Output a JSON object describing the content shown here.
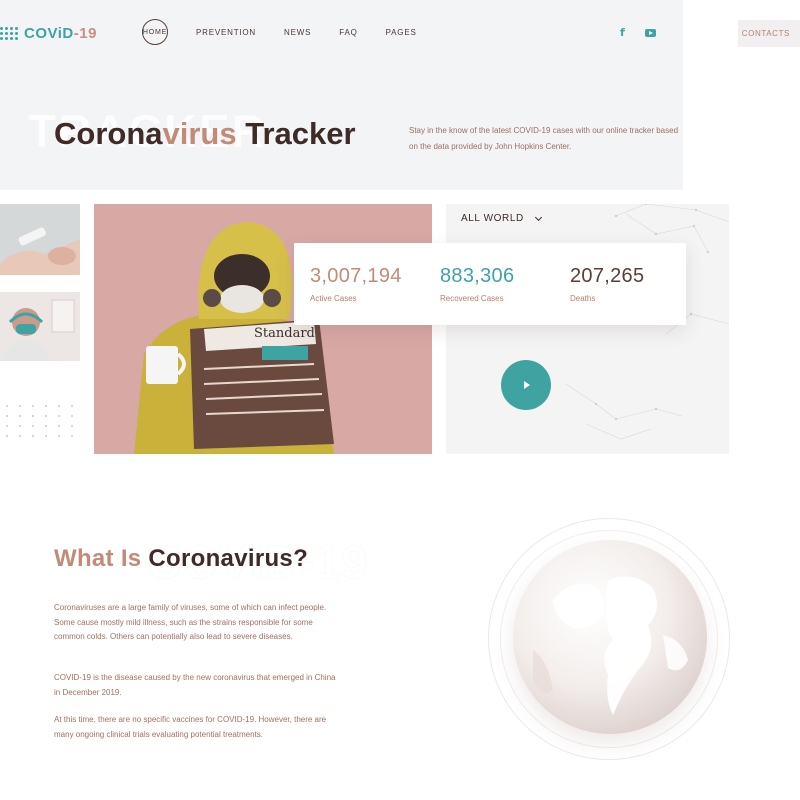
{
  "brand": {
    "name": "COViD",
    "suffix": "-19"
  },
  "nav": {
    "items": [
      "HOME",
      "PREVENTION",
      "NEWS",
      "FAQ",
      "PAGES"
    ]
  },
  "header": {
    "contacts_label": "CONTACTS",
    "social_icons": [
      "facebook-icon",
      "youtube-icon"
    ]
  },
  "hero": {
    "ghost_text": "TRACKER",
    "title_part1": "Corona",
    "title_part2": "virus",
    "title_part3": " Tracker",
    "description": "Stay in the know of the latest COVID-19 cases with our online tracker based on the data provided by John Hopkins Center."
  },
  "tracker": {
    "region": "ALL WORLD",
    "stats": [
      {
        "value": "3,007,194",
        "label": "Active Cases",
        "color": "#c38a77"
      },
      {
        "value": "883,306",
        "label": "Recovered Cases",
        "color": "#3fa3a2"
      },
      {
        "value": "207,265",
        "label": "Deaths",
        "color": "#5a3e36"
      }
    ]
  },
  "about": {
    "ghost_text": "COVID-19",
    "title_light": "What Is ",
    "title_bold": "Coronavirus?",
    "paragraphs": [
      "Coronaviruses are a large family of viruses, some of which can infect people. Some cause mostly mild illness, such as the strains responsible for some common colds. Others can potentially also lead to severe diseases.",
      "COVID-19 is the disease caused by the new coronavirus that emerged in China in December 2019.",
      "At this time, there are no specific vaccines for COVID-19. However, there are many ongoing clinical trials evaluating potential treatments."
    ]
  },
  "colors": {
    "teal": "#3fa3a2",
    "rose": "#c38a77",
    "dark_brown": "#3f2a25"
  }
}
